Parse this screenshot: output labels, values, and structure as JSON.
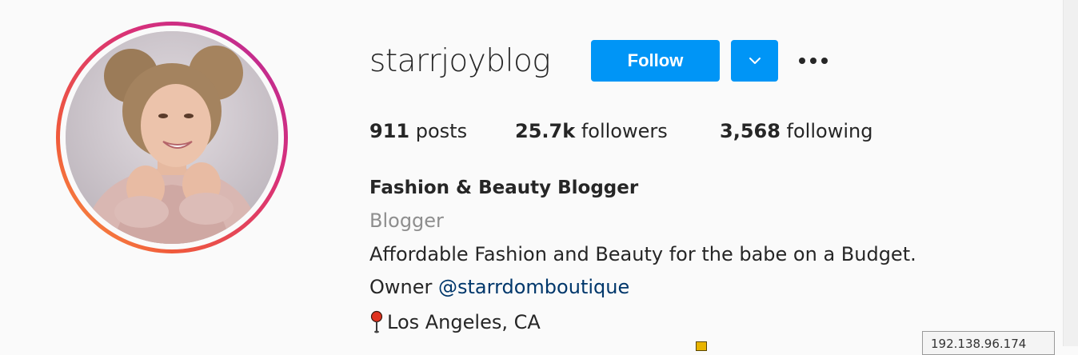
{
  "profile": {
    "username": "starrjoyblog",
    "follow_label": "Follow",
    "stats": {
      "posts_count": "911",
      "posts_label": " posts",
      "followers_count": "25.7k",
      "followers_label": " followers",
      "following_count": "3,568",
      "following_label": " following"
    },
    "bio": {
      "full_name": "Fashion & Beauty Blogger",
      "category": "Blogger",
      "description": "Affordable Fashion and Beauty for the babe on a Budget.",
      "owner_prefix": "Owner ",
      "owner_mention": "@starrdomboutique",
      "location": "Los Angeles, CA"
    }
  },
  "overlay": {
    "ip_tooltip": "192.138.96.174"
  },
  "icons": {
    "avatar": "profile-photo",
    "dropdown": "chevron-down-icon",
    "more": "more-options-icon",
    "location": "round-pushpin-icon"
  },
  "colors": {
    "primary_button": "#0095f6",
    "mention_link": "#00376b",
    "secondary_text": "#8e8e8e",
    "story_ring_start": "#b62a9c",
    "story_ring_end": "#fca445"
  }
}
